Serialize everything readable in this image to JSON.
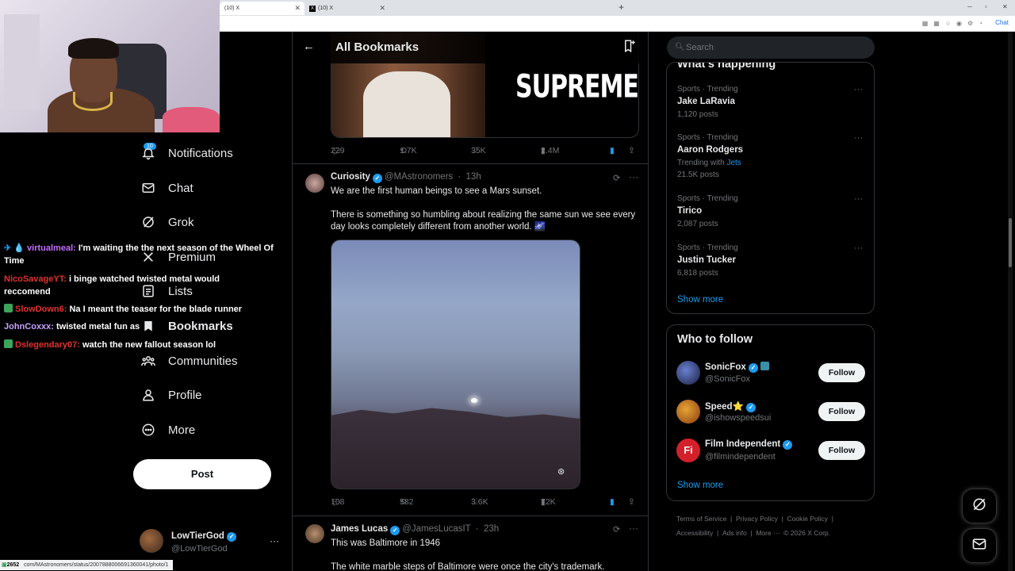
{
  "browser": {
    "tabs": [
      {
        "label": "(10) X"
      },
      {
        "label": "(10) X"
      }
    ],
    "chat_button": "Chat"
  },
  "nav": {
    "notifications_badge": "10",
    "items": [
      {
        "label": "Notifications",
        "icon": "bell-icon"
      },
      {
        "label": "Chat",
        "icon": "mail-icon"
      },
      {
        "label": "Grok",
        "icon": "grok-icon"
      },
      {
        "label": "Premium",
        "icon": "x-logo-icon"
      },
      {
        "label": "Lists",
        "icon": "list-icon"
      },
      {
        "label": "Bookmarks",
        "icon": "bookmark-icon"
      },
      {
        "label": "Communities",
        "icon": "communities-icon"
      },
      {
        "label": "Profile",
        "icon": "person-icon"
      },
      {
        "label": "More",
        "icon": "more-circle-icon"
      }
    ],
    "post_button": "Post",
    "account": {
      "name": "LowTierGod",
      "handle": "@LowTierGod"
    }
  },
  "stream_chat": [
    {
      "user": "virtualmeal",
      "color": "#c46cff",
      "message": "I'm waiting the the next season of the Wheel Of Time"
    },
    {
      "user": "NicoSavageYT",
      "color": "#e0322f",
      "message": "i binge watched twisted metal would reccomend"
    },
    {
      "user": "SlowDown6",
      "color": "#e0322f",
      "message": "Na I meant the teaser for the blade runner"
    },
    {
      "user": "JohnCoxxx",
      "color": "#c9a0ff",
      "message": "twisted metal fun as"
    },
    {
      "user": "Dslegendary07",
      "color": "#e0322f",
      "message": "watch the new fallout season lol"
    }
  ],
  "main": {
    "title": "All Bookmarks",
    "prev_tweet": {
      "media_text": "SUPREME",
      "stats": {
        "replies": "229",
        "reposts": "1.7K",
        "likes": "35K",
        "views": "2.4M"
      }
    },
    "tweets": [
      {
        "name": "Curiosity",
        "handle": "@MAstronomers",
        "time": "13h",
        "line1": "We are the first human beings to see a Mars sunset.",
        "line2": "There is something so humbling about realizing the same sun we see every day looks completely different from another world. 🌌",
        "stats": {
          "replies": "108",
          "reposts": "582",
          "likes": "3.6K",
          "views": "72K"
        }
      },
      {
        "name": "James Lucas",
        "handle": "@JamesLucasIT",
        "time": "23h",
        "line1": "This was Baltimore in 1946",
        "line2": "The white marble steps of Baltimore were once the city's trademark."
      }
    ]
  },
  "right": {
    "search_placeholder": "Search",
    "whats_happening": "What's happening",
    "trends": [
      {
        "category": "Sports · Trending",
        "name": "Jake LaRavia",
        "count": "1,120 posts"
      },
      {
        "category": "Sports · Trending",
        "name": "Aaron Rodgers",
        "with_prefix": "Trending with",
        "with_link": "Jets",
        "count": "21.5K posts"
      },
      {
        "category": "Sports · Trending",
        "name": "Tirico",
        "count": "2,087 posts"
      },
      {
        "category": "Sports · Trending",
        "name": "Justin Tucker",
        "count": "6,818 posts"
      }
    ],
    "show_more": "Show more",
    "who_to_follow": "Who to follow",
    "suggestions": [
      {
        "name": "SonicFox",
        "handle": "@SonicFox",
        "button": "Follow"
      },
      {
        "name": "Speed⭐",
        "handle": "@ishowspeedsui",
        "button": "Follow"
      },
      {
        "name": "Film Independent",
        "handle": "@filmindependent",
        "button": "Follow"
      }
    ],
    "footer": {
      "line1": [
        "Terms of Service",
        "Privacy Policy",
        "Cookie Policy"
      ],
      "line2": [
        "Accessibility",
        "Ads info",
        "More ···",
        "© 2026 X Corp."
      ]
    }
  },
  "status_url": "com/MAstronomers/status/2007888006691360041/photo/1",
  "viewer_count": "2652",
  "colors": {
    "accent": "#1d9bf0",
    "background": "#000000",
    "muted": "#71767b"
  }
}
